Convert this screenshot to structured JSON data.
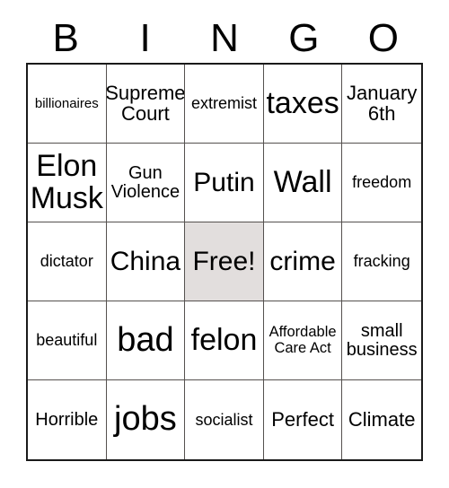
{
  "card": {
    "title_letters": [
      "B",
      "I",
      "N",
      "G",
      "O"
    ],
    "free_space_color": "#e2dedd",
    "border_color": "#1a1a1a",
    "grid_line_color": "#55514f",
    "text_color": "#000000",
    "rows": [
      [
        {
          "text": "billionaires",
          "size": "fs-15",
          "free": false
        },
        {
          "text": "Supreme\nCourt",
          "size": "fs-22",
          "free": false
        },
        {
          "text": "extremist",
          "size": "fs-18",
          "free": false
        },
        {
          "text": "taxes",
          "size": "fs-34",
          "free": false
        },
        {
          "text": "January\n6th",
          "size": "fs-22",
          "free": false
        }
      ],
      [
        {
          "text": "Elon\nMusk",
          "size": "fs-34",
          "free": false
        },
        {
          "text": "Gun\nViolence",
          "size": "fs-20",
          "free": false
        },
        {
          "text": "Putin",
          "size": "fs-30",
          "free": false
        },
        {
          "text": "Wall",
          "size": "fs-34",
          "free": false
        },
        {
          "text": "freedom",
          "size": "fs-18",
          "free": false
        }
      ],
      [
        {
          "text": "dictator",
          "size": "fs-18",
          "free": false
        },
        {
          "text": "China",
          "size": "fs-30",
          "free": false
        },
        {
          "text": "Free!",
          "size": "fs-30",
          "free": true
        },
        {
          "text": "crime",
          "size": "fs-30",
          "free": false
        },
        {
          "text": "fracking",
          "size": "fs-18",
          "free": false
        }
      ],
      [
        {
          "text": "beautiful",
          "size": "fs-18",
          "free": false
        },
        {
          "text": "bad",
          "size": "fs-38",
          "free": false
        },
        {
          "text": "felon",
          "size": "fs-34",
          "free": false
        },
        {
          "text": "Affordable\nCare Act",
          "size": "fs-16",
          "free": false
        },
        {
          "text": "small\nbusiness",
          "size": "fs-20",
          "free": false
        }
      ],
      [
        {
          "text": "Horrible",
          "size": "fs-20",
          "free": false
        },
        {
          "text": "jobs",
          "size": "fs-38",
          "free": false
        },
        {
          "text": "socialist",
          "size": "fs-18",
          "free": false
        },
        {
          "text": "Perfect",
          "size": "fs-22",
          "free": false
        },
        {
          "text": "Climate",
          "size": "fs-22",
          "free": false
        }
      ]
    ]
  }
}
